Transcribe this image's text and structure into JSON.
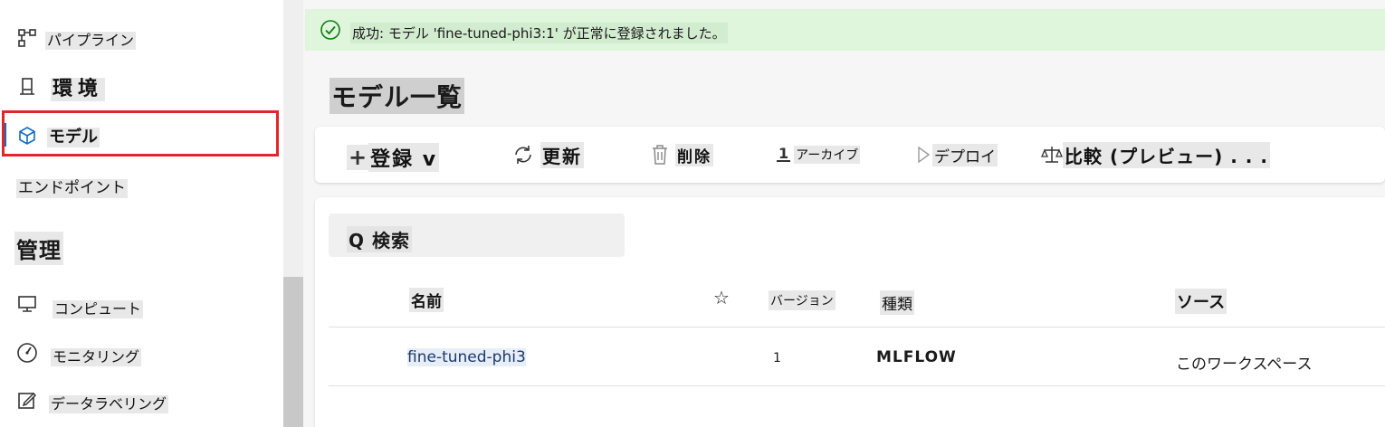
{
  "sidebar": {
    "items": [
      {
        "label": "パイプライン",
        "icon": "pipeline-icon"
      },
      {
        "label": "環境",
        "icon": "environment-icon"
      },
      {
        "label": "モデル",
        "icon": "model-cube-icon"
      },
      {
        "label": "エンドポイント",
        "icon": "endpoint-icon"
      },
      {
        "label": "コンピュート",
        "icon": "compute-icon"
      },
      {
        "label": "モニタリング",
        "icon": "monitoring-icon"
      },
      {
        "label": "データラベリング",
        "icon": "data-labeling-icon"
      }
    ],
    "section_title": "管理",
    "selected": "モデル"
  },
  "toast": {
    "message": "成功: モデル 'fine-tuned-phi3:1' が正常に登録されました。",
    "icon": "check-circle-icon"
  },
  "page": {
    "title": "モデル一覧"
  },
  "toolbar": {
    "register": "登録 v",
    "refresh": "更新",
    "delete": "削除",
    "archive": "アーカイブ",
    "archive_icon_text": "1",
    "deploy": "デプロイ",
    "compare": "比較 (プレビュー) . . ."
  },
  "search": {
    "label": "Q 検索"
  },
  "table": {
    "columns": {
      "name": "名前",
      "favorite": "☆",
      "version": "バージョン",
      "type": "種類",
      "source": "ソース"
    },
    "rows": [
      {
        "name": "fine-tuned-phi3",
        "version": "1",
        "type": "MLFLOW",
        "source": "このワークスペース"
      }
    ]
  },
  "colors": {
    "accent": "#0f6cbd",
    "highlight_box": "#e0252b",
    "toast_bg": "#dff6dd",
    "toast_icon": "#107c10"
  }
}
